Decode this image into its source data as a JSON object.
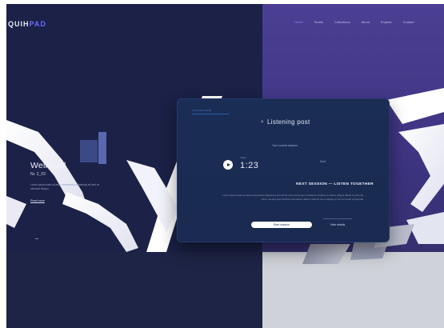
{
  "header": {
    "logo_main": "QUIH",
    "logo_accent": "PAD",
    "nav": [
      "Home",
      "Studio",
      "Collections",
      "About",
      "Explore",
      "Contact"
    ]
  },
  "info_card": {
    "title": "Wellword",
    "subtitle": "Nr. 2_03",
    "text": "Lorem ipsum dolor sit amet consectetur adipiscing elit sed do eiusmod tempor",
    "link": "Read more"
  },
  "modal": {
    "tab": "Overview panel",
    "title": "Listening post",
    "caption": "Your current session",
    "player_label": "Track",
    "player_time": "1:23",
    "player_side": "Next",
    "heading": "NEXT SESSION — LISTEN TOGETHER",
    "description": "Lorem ipsum dolor sit amet consectetur adipiscing elit sed do eiusmod tempor incididunt ut labore et dolore magna aliqua ut enim ad minim veniam quis nostrud exercitation ullamco laboris nisi ut aliquip ex ea commodo consequat",
    "primary_button": "Start session",
    "secondary_button": "View details",
    "close_icon": "×"
  },
  "colors": {
    "navy": "#1b2147",
    "violet": "#4b3f93",
    "modal": "#1a2d55",
    "accent": "#6d69ff"
  }
}
